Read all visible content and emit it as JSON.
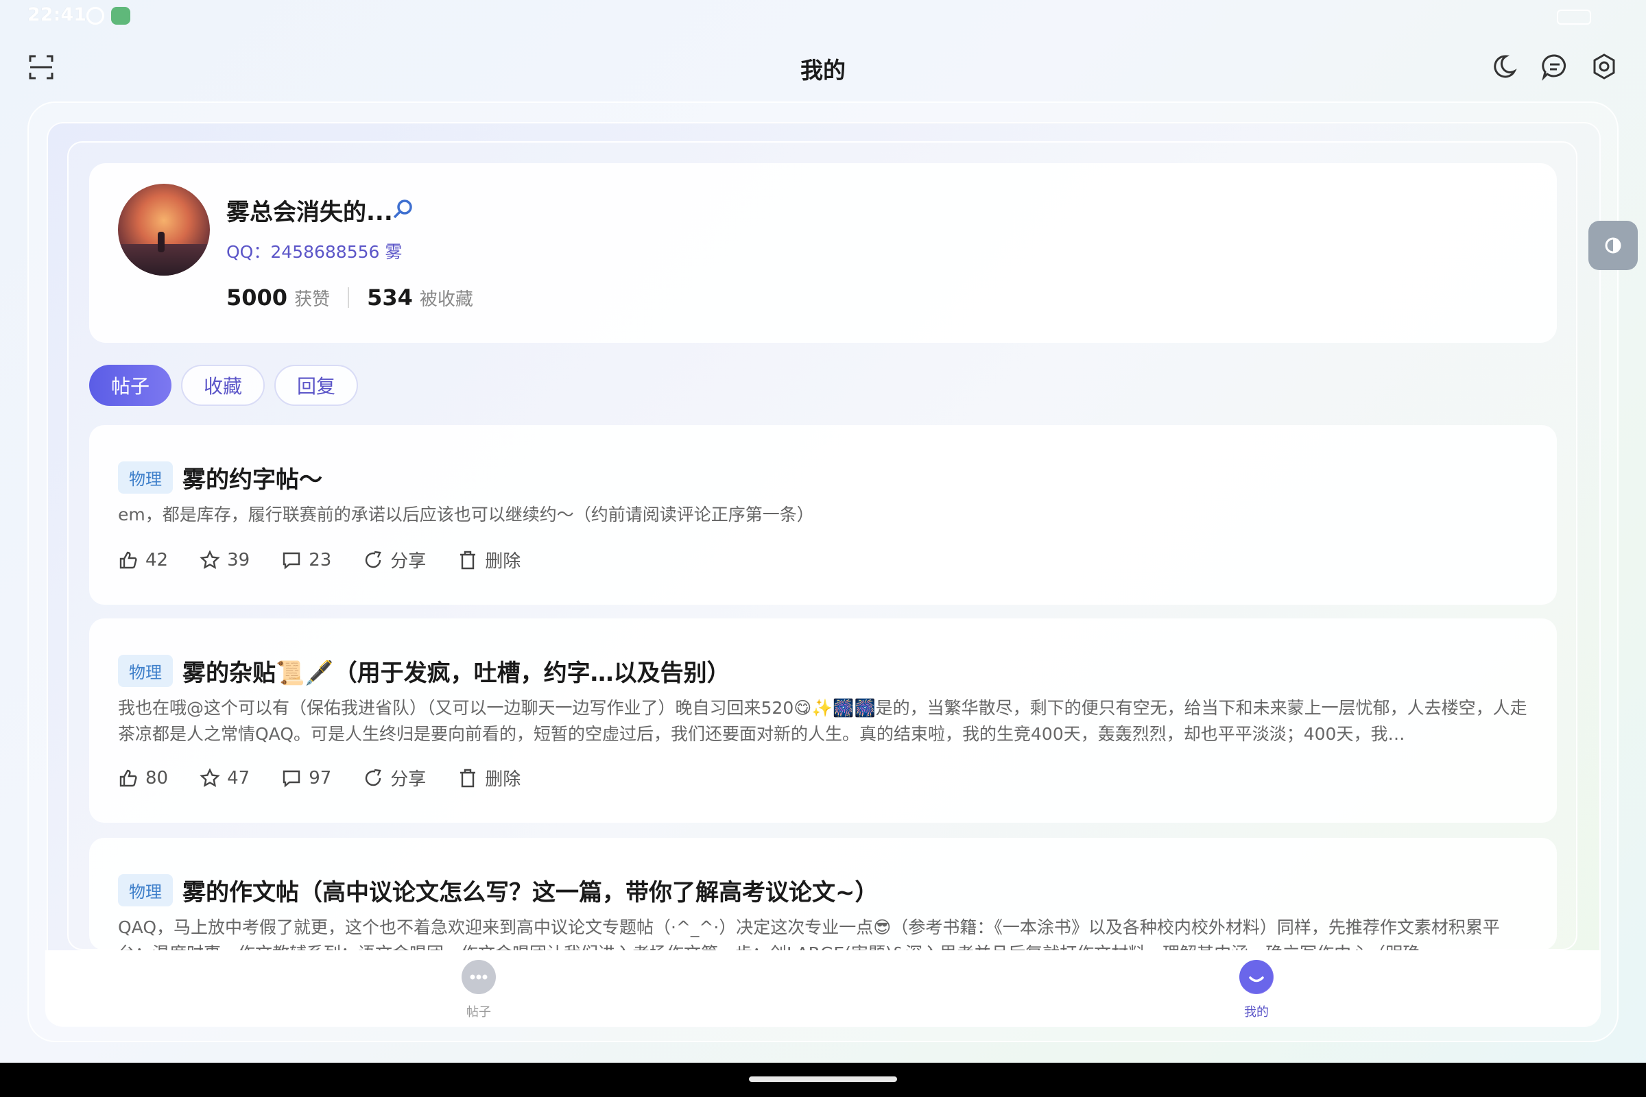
{
  "status_bar": {
    "time": "22:41"
  },
  "header": {
    "title": "我的"
  },
  "profile": {
    "username": "雾总会消失的...",
    "qq": "QQ：2458688556 雾",
    "likes_count": "5000",
    "likes_label": "获赞",
    "favorites_count": "534",
    "favorites_label": "被收藏"
  },
  "tabs": [
    {
      "label": "帖子",
      "active": true
    },
    {
      "label": "收藏",
      "active": false
    },
    {
      "label": "回复",
      "active": false
    }
  ],
  "posts": [
    {
      "tag": "物理",
      "title": "雾的约字帖～",
      "body": "em，都是库存，履行联赛前的承诺以后应该也可以继续约～（约前请阅读评论正序第一条）",
      "likes": "42",
      "stars": "39",
      "comments": "23",
      "share_label": "分享",
      "delete_label": "删除"
    },
    {
      "tag": "物理",
      "title": "雾的杂贴📜🖋️（用于发疯，吐槽，约字…以及告别）",
      "body": "我也在哦@这个可以有（保佑我进省队）（又可以一边聊天一边写作业了）晚自习回来520😋✨🎆🎆是的，当繁华散尽，剩下的便只有空无，给当下和未来蒙上一层忧郁，人去楼空，人走茶凉都是人之常情QAQ。可是人生终归是要向前看的，短暂的空虚过后，我们还要面对新的人生。真的结束啦，我的生竞400天，轰轰烈烈，却也平平淡淡；400天，我…",
      "likes": "80",
      "stars": "47",
      "comments": "97",
      "share_label": "分享",
      "delete_label": "删除"
    },
    {
      "tag": "物理",
      "title": "雾的作文帖（高中议论文怎么写？这一篇，带你了解高考议论文~）",
      "body": "QAQ，马上放中考假了就更，这个也不着急欢迎来到高中议论文专题帖（·^_^·）决定这次专业一点😎（参考书籍：《一本涂书》以及各种校内校外材料）同样，先推荐作文素材积累平台：温度时事，作文教辅系列：语文金唱团，作文金唱团让我们进入考场作文第一步：创LARGE(审题)&深入思考并且后复就打作文材料，理解其内涵，确立写作中心（明确"
    }
  ],
  "bottom_nav": {
    "posts_label": "帖子",
    "mine_label": "我的"
  },
  "icons": {
    "scan": "scan-icon",
    "moon": "moon-icon",
    "message": "message-icon",
    "settings": "settings-icon",
    "verify": "verify-icon",
    "like": "thumb-up-icon",
    "star": "star-icon",
    "comment": "comment-icon",
    "share": "share-icon",
    "delete": "trash-icon",
    "theme": "contrast-icon"
  },
  "colors": {
    "accent": "#5b5de6",
    "tag_bg": "#e4f0fc",
    "tag_text": "#3e7fca",
    "qq_text": "#5b55c8"
  }
}
